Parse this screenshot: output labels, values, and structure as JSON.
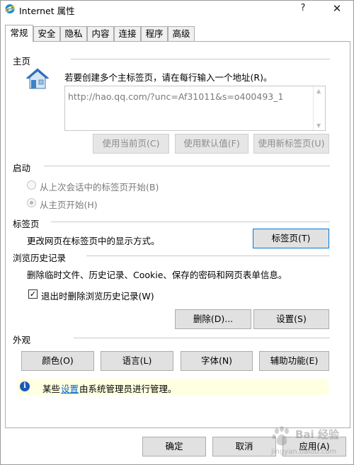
{
  "window": {
    "title": "Internet 属性",
    "help_glyph": "?",
    "close_glyph": "✕"
  },
  "tabs": [
    {
      "label": "常规",
      "active": true
    },
    {
      "label": "安全"
    },
    {
      "label": "隐私"
    },
    {
      "label": "内容"
    },
    {
      "label": "连接"
    },
    {
      "label": "程序"
    },
    {
      "label": "高级"
    }
  ],
  "home": {
    "section": "主页",
    "prompt": "若要创建多个主标签页，请在每行输入一个地址(R)。",
    "url_value": "http://hao.qq.com/?unc=Af31011&s=o400493_1",
    "use_current": "使用当前页(C)",
    "use_default": "使用默认值(F)",
    "use_new_tab": "使用新标签页(U)"
  },
  "startup": {
    "section": "启动",
    "option1": "从上次会话中的标签页开始(B)",
    "option2": "从主页开始(H)"
  },
  "tabs_section": {
    "section": "标签页",
    "desc": "更改网页在标签页中的显示方式。",
    "button": "标签页(T)"
  },
  "history": {
    "section": "浏览历史记录",
    "desc": "删除临时文件、历史记录、Cookie、保存的密码和网页表单信息。",
    "checkbox_label": "退出时删除浏览历史记录(W)",
    "checkbox_checked": true,
    "delete_button": "删除(D)...",
    "settings_button": "设置(S)"
  },
  "appearance": {
    "section": "外观",
    "colors": "颜色(O)",
    "languages": "语言(L)",
    "fonts": "字体(N)",
    "accessibility": "辅助功能(E)"
  },
  "infobar": {
    "prefix": "某些",
    "link": "设置",
    "suffix": "由系统管理员进行管理。"
  },
  "footer": {
    "ok": "确定",
    "cancel": "取消",
    "apply": "应用(A)"
  },
  "watermark": {
    "text": "Bai 经验",
    "url": "jingyan.baidu.com"
  },
  "colors": {
    "accent": "#0078d7",
    "info_bg": "#ffffe1",
    "link": "#0066cc"
  }
}
